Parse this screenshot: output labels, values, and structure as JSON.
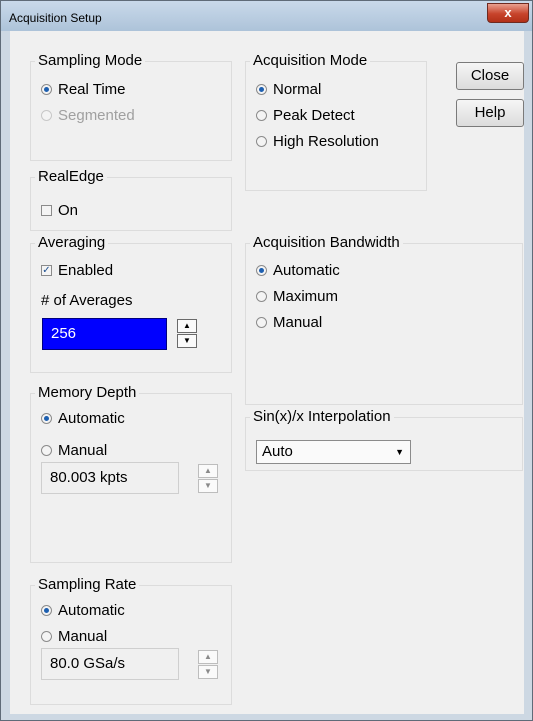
{
  "window": {
    "title": "Acquisition Setup",
    "close_glyph": "x"
  },
  "buttons": {
    "close": "Close",
    "help": "Help"
  },
  "sampling_mode": {
    "legend": "Sampling Mode",
    "options": [
      "Real Time",
      "Segmented"
    ],
    "selected": "Real Time"
  },
  "acquisition_mode": {
    "legend": "Acquisition Mode",
    "options": [
      "Normal",
      "Peak Detect",
      "High Resolution"
    ],
    "selected": "Normal"
  },
  "realedge": {
    "legend": "RealEdge",
    "checkbox_label": "On",
    "checked": false
  },
  "averaging": {
    "legend": "Averaging",
    "enabled_label": "Enabled",
    "enabled_checked": true,
    "count_label": "# of Averages",
    "count_value": "256"
  },
  "acquisition_bandwidth": {
    "legend": "Acquisition Bandwidth",
    "options": [
      "Automatic",
      "Maximum",
      "Manual"
    ],
    "selected": "Automatic"
  },
  "memory_depth": {
    "legend": "Memory Depth",
    "options": [
      "Automatic",
      "Manual"
    ],
    "selected": "Automatic",
    "value": "80.003 kpts"
  },
  "interpolation": {
    "legend": "Sin(x)/x Interpolation",
    "selected": "Auto"
  },
  "sampling_rate": {
    "legend": "Sampling Rate",
    "options": [
      "Automatic",
      "Manual"
    ],
    "selected": "Automatic",
    "value": "80.0 GSa/s"
  },
  "icons": {
    "spin_up": "up-arrow-icon",
    "spin_down": "down-arrow-icon",
    "dropdown": "chevron-down-icon"
  }
}
